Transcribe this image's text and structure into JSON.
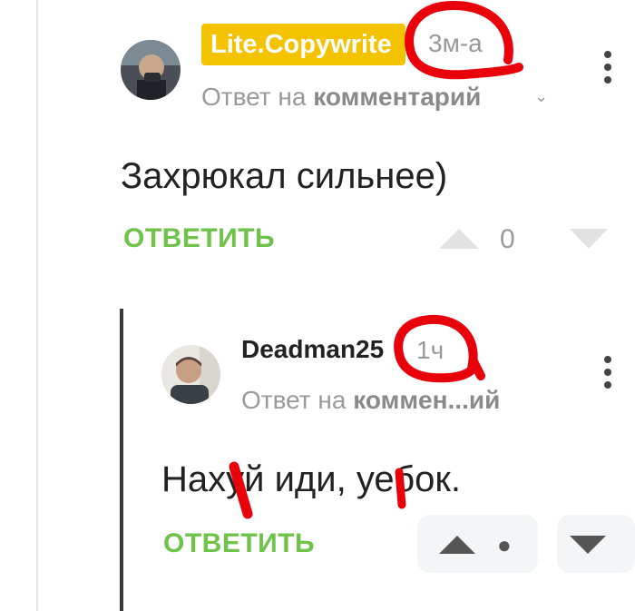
{
  "comment1": {
    "author": "Lite.Copywrite",
    "time": "3м-а",
    "reply_to_prefix": "Ответ на",
    "reply_to_target": "комментарий",
    "text": "Захрюкал сильнее)",
    "reply_label": "ОТВЕТИТЬ",
    "rating": "0",
    "badge_color": "#f3c300"
  },
  "comment2": {
    "author": "Deadman25",
    "time": "1ч",
    "reply_to_prefix": "Ответ на",
    "reply_to_target": "коммен...ий",
    "text": "Нахуй иди, уебок.",
    "reply_label": "ОТВЕТИТЬ",
    "rating": "●"
  },
  "icons": [
    "vote-up-icon",
    "vote-down-icon",
    "more-options-icon",
    "chevron-down-icon"
  ],
  "colors": {
    "accent_green": "#6fc24a",
    "annotation_red": "#e8000b",
    "muted_text": "#9a9a9a"
  }
}
